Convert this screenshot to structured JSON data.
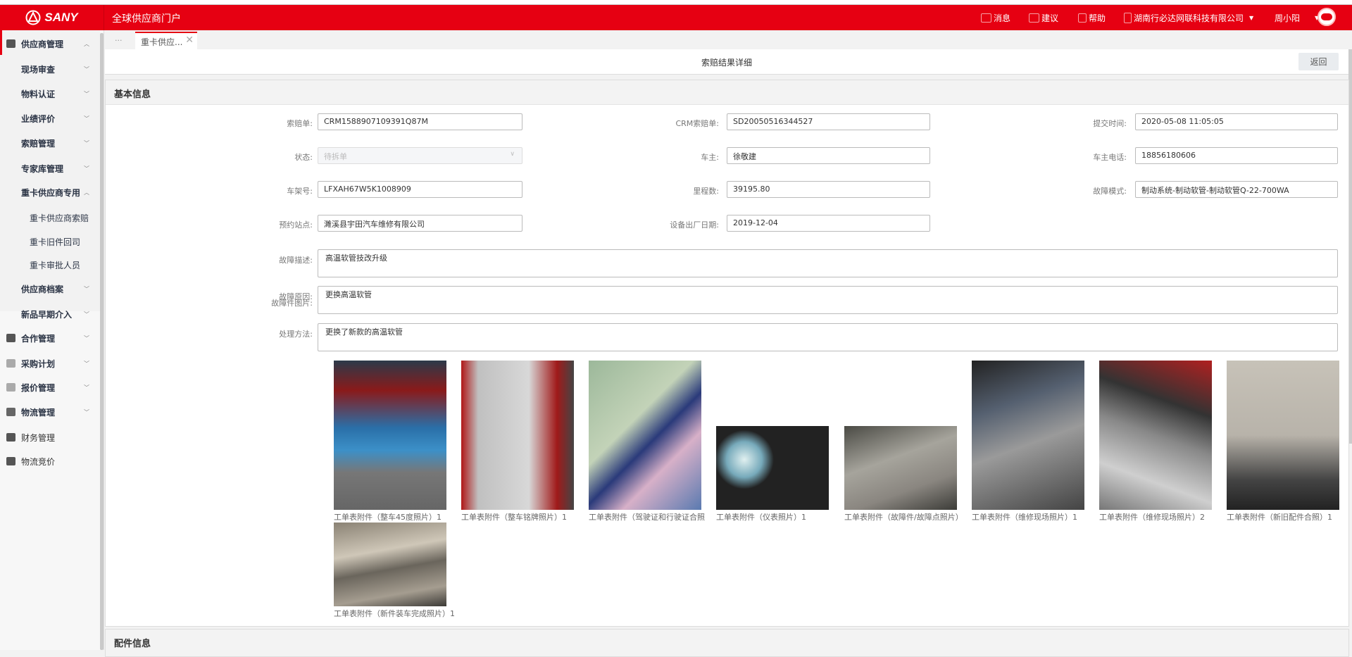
{
  "header": {
    "logo_text": "SANY",
    "app_title": "全球供应商门户",
    "messages": "消息",
    "suggestions": "建议",
    "help": "帮助",
    "company": "湖南行必达网联科技有限公司",
    "user": "周小阳",
    "brand_color": "#e60012"
  },
  "sidebar": {
    "items": [
      {
        "label": "供应商管理",
        "icon": "user-gear-icon",
        "expanded": true
      },
      {
        "label": "现场审查"
      },
      {
        "label": "物料认证"
      },
      {
        "label": "业绩评价"
      },
      {
        "label": "索赔管理"
      },
      {
        "label": "专家库管理"
      },
      {
        "label": "重卡供应商专用",
        "expanded": true
      },
      {
        "label": "重卡供应商索赔"
      },
      {
        "label": "重卡旧件回司"
      },
      {
        "label": "重卡审批人员"
      },
      {
        "label": "供应商档案"
      },
      {
        "label": "新品早期介入"
      },
      {
        "label": "合作管理",
        "icon": "network-icon"
      },
      {
        "label": "采购计划",
        "icon": "grid-icon"
      },
      {
        "label": "报价管理",
        "icon": "grid-icon"
      },
      {
        "label": "物流管理",
        "icon": "route-icon"
      },
      {
        "label": "财务管理",
        "icon": "bar-chart-icon"
      },
      {
        "label": "物流竞价",
        "icon": "monitor-icon"
      }
    ]
  },
  "tabs": {
    "more": "···",
    "active": "重卡供应..."
  },
  "page": {
    "title": "索赔结果详细",
    "back": "返回"
  },
  "basic": {
    "section_title": "基本信息",
    "fields": {
      "claim_no": {
        "label": "索赔单:",
        "value": "CRM1588907109391Q87M"
      },
      "crm_claim_no": {
        "label": "CRM索赔单:",
        "value": "SD20050516344527"
      },
      "submit_time": {
        "label": "提交时间:",
        "value": "2020-05-08 11:05:05"
      },
      "status": {
        "label": "状态:",
        "value": "待拆单"
      },
      "owner": {
        "label": "车主:",
        "value": "徐敬建"
      },
      "owner_phone": {
        "label": "车主电话:",
        "value": "18856180606"
      },
      "vin": {
        "label": "车架号:",
        "value": "LFXAH67W5K1008909"
      },
      "mileage": {
        "label": "里程数:",
        "value": "39195.80"
      },
      "fault_mode": {
        "label": "故障模式:",
        "value": "制动系统-制动软管-制动软管Q-22-700WA"
      },
      "station": {
        "label": "预约站点:",
        "value": "濉溪县宇田汽车维修有限公司"
      },
      "factory_date": {
        "label": "设备出厂日期:",
        "value": "2019-12-04"
      },
      "fault_desc": {
        "label": "故障描述:",
        "value": "高温软管技改升级"
      },
      "fault_cause": {
        "label": "故障原因:",
        "value": "更换高温软管"
      },
      "solution": {
        "label": "处理方法:",
        "value": "更换了新款的高温软管"
      }
    },
    "photos_label": "故障件图片:",
    "photos": [
      {
        "caption": "工单表附件（整车45度照片）1"
      },
      {
        "caption": "工单表附件（整车铭牌照片）1"
      },
      {
        "caption": "工单表附件（驾驶证和行驶证合照"
      },
      {
        "caption": "工单表附件（仪表照片）1"
      },
      {
        "caption": "工单表附件（故障件/故障点照片）"
      },
      {
        "caption": "工单表附件（维修现场照片）1"
      },
      {
        "caption": "工单表附件（维修现场照片）2"
      },
      {
        "caption": "工单表附件（新旧配件合照）1"
      },
      {
        "caption": "工单表附件（新件装车完成照片）1"
      }
    ]
  },
  "parts": {
    "section_title": "配件信息"
  }
}
